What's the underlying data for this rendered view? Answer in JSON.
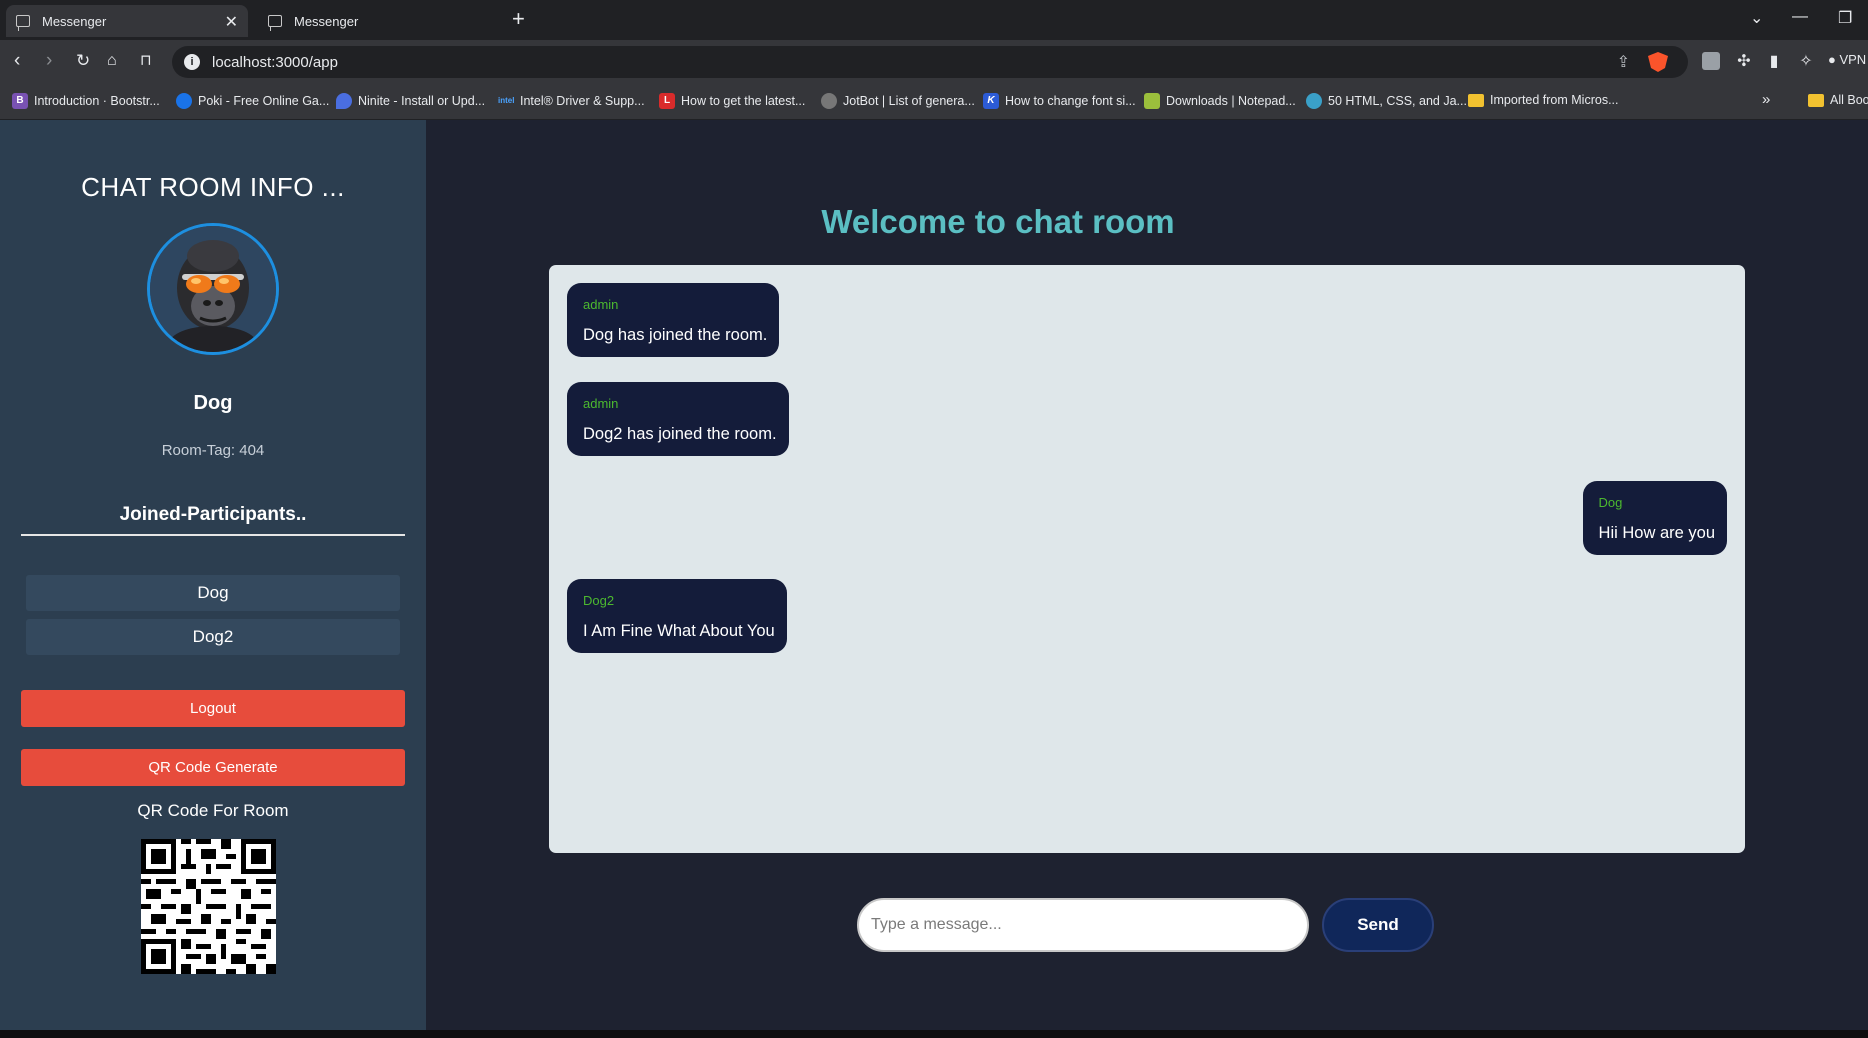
{
  "browser": {
    "tabs": [
      {
        "label": "Messenger",
        "active": true
      },
      {
        "label": "Messenger",
        "active": false
      }
    ],
    "url": "localhost:3000/app",
    "vpn_label": "VPN",
    "bookmarks": [
      {
        "label": "Introduction · Bootstr...",
        "icon": "bootstrap-icon",
        "color": "#7952b3"
      },
      {
        "label": "Poki - Free Online Ga...",
        "icon": "poki-icon",
        "color": "#1a73e8"
      },
      {
        "label": "Ninite - Install or Upd...",
        "icon": "ninite-icon",
        "color": "#4a6ee0"
      },
      {
        "label": "Intel® Driver & Supp...",
        "icon": "intel-icon",
        "color": "#0068b5"
      },
      {
        "label": "How to get the latest...",
        "icon": "l-icon",
        "color": "#d92b2b"
      },
      {
        "label": "JotBot | List of genera...",
        "icon": "jotbot-icon",
        "color": "#777777"
      },
      {
        "label": "How to change font si...",
        "icon": "k-icon",
        "color": "#2c5bd6"
      },
      {
        "label": "Downloads | Notepad...",
        "icon": "notepad-icon",
        "color": "#9bbf3c"
      },
      {
        "label": "50 HTML, CSS, and Ja...",
        "icon": "globe-icon",
        "color": "#3aa0c8"
      },
      {
        "label": "Imported from Micros...",
        "icon": "folder-icon",
        "color": "#f2c230"
      }
    ],
    "all_bookmarks_label": "All Boo"
  },
  "sidebar": {
    "title": "CHAT ROOM INFO ...",
    "username": "Dog",
    "room_tag_label": "Room-Tag:",
    "room_tag_value": "404",
    "participants_heading": "Joined-Participants..",
    "participants": [
      "Dog",
      "Dog2"
    ],
    "logout_label": "Logout",
    "qr_button_label": "QR Code Generate",
    "qr_title": "QR Code For Room"
  },
  "main": {
    "welcome": "Welcome to chat room",
    "messages": [
      {
        "sender": "admin",
        "text": "Dog has joined the room.",
        "side": "left"
      },
      {
        "sender": "admin",
        "text": "Dog2 has joined the room.",
        "side": "left"
      },
      {
        "sender": "Dog",
        "text": "Hii How are you",
        "side": "right"
      },
      {
        "sender": "Dog2",
        "text": "I Am Fine What About You",
        "side": "left"
      }
    ],
    "composer_placeholder": "Type a message...",
    "send_label": "Send"
  },
  "colors": {
    "sidebar_bg": "#2c3e50",
    "main_bg": "#1e2230",
    "accent_teal": "#5bbfc3",
    "danger": "#e74c3c",
    "bubble_bg": "#141c3a",
    "sender_green": "#4cb92f",
    "send_button": "#10275a"
  }
}
